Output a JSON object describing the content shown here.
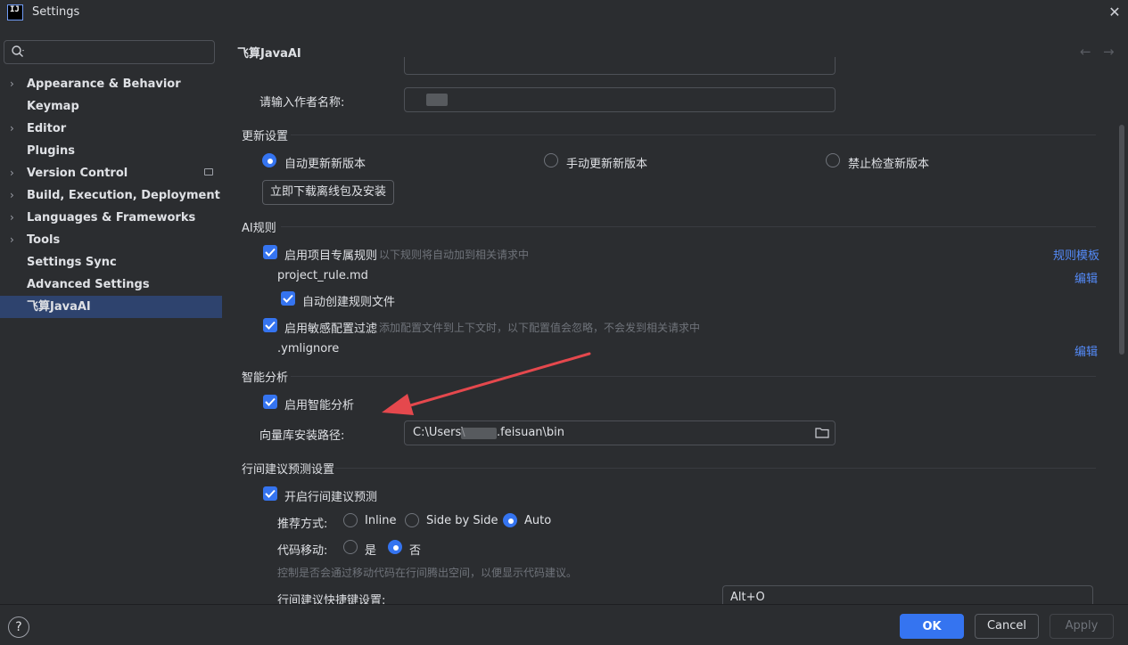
{
  "window": {
    "title": "Settings",
    "app_icon_text": "IJ"
  },
  "search": {
    "placeholder": "",
    "icon": "search-icon"
  },
  "sidebar": {
    "items": [
      {
        "label": "Appearance & Behavior",
        "expandable": true
      },
      {
        "label": "Keymap",
        "expandable": false
      },
      {
        "label": "Editor",
        "expandable": true
      },
      {
        "label": "Plugins",
        "expandable": false
      },
      {
        "label": "Version Control",
        "expandable": true
      },
      {
        "label": "Build, Execution, Deployment",
        "expandable": true
      },
      {
        "label": "Languages & Frameworks",
        "expandable": true
      },
      {
        "label": "Tools",
        "expandable": true
      },
      {
        "label": "Settings Sync",
        "expandable": false
      },
      {
        "label": "Advanced Settings",
        "expandable": false
      },
      {
        "label": "飞算JavaAI",
        "expandable": false,
        "selected": true
      }
    ]
  },
  "content": {
    "title": "飞算JavaAI",
    "author": {
      "label": "请输入作者名称:"
    },
    "update": {
      "section": "更新设置",
      "options": [
        "自动更新新版本",
        "手动更新新版本",
        "禁止检查新版本"
      ],
      "selected_index": 0,
      "download_button": "立即下载离线包及安装"
    },
    "ai_rules": {
      "section": "AI规则",
      "project_rules": {
        "label": "启用项目专属规则",
        "hint": "以下规则将自动加到相关请求中",
        "checked": true,
        "link": "规则模板"
      },
      "rule_file": {
        "name": "project_rule.md",
        "edit": "编辑"
      },
      "auto_create": {
        "label": "自动创建规则文件",
        "checked": true
      },
      "sensitive": {
        "label": "启用敏感配置过滤",
        "hint": "添加配置文件到上下文时，以下配置值会忽略，不会发到相关请求中",
        "checked": true
      },
      "ignore_file": {
        "name": ".ymlignore",
        "edit": "编辑"
      }
    },
    "smart": {
      "section": "智能分析",
      "enable": {
        "label": "启用智能分析",
        "checked": true
      },
      "path_label": "向量库安装路径:",
      "path_prefix": "C:\\Users\\",
      "path_suffix": ".feisuan\\bin"
    },
    "inline": {
      "section": "行间建议预测设置",
      "enable": {
        "label": "开启行间建议预测",
        "checked": true
      },
      "mode_label": "推荐方式:",
      "modes": [
        "Inline",
        "Side by Side",
        "Auto"
      ],
      "mode_selected": 2,
      "move_label": "代码移动:",
      "move_options": [
        "是",
        "否"
      ],
      "move_selected": 1,
      "move_hint": "控制是否会通过移动代码在行间腾出空间，以便显示代码建议。",
      "shortcut_label": "行间建议快捷键设置:",
      "shortcut_value": "Alt+O"
    }
  },
  "footer": {
    "help": "?",
    "ok": "OK",
    "cancel": "Cancel",
    "apply": "Apply"
  },
  "colors": {
    "accent": "#3574f0",
    "link": "#548af7",
    "arrow": "#e5484d",
    "selection": "#2e436e"
  }
}
